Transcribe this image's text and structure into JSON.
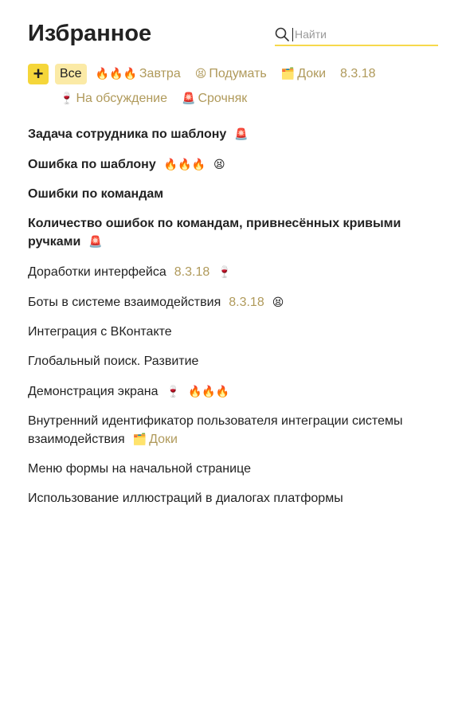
{
  "header": {
    "title": "Избранное",
    "search_placeholder": "Найти"
  },
  "filters": {
    "add_label": "+",
    "row1": [
      {
        "emoji": "",
        "label": "Все",
        "active": true
      },
      {
        "emoji": "🔥🔥🔥",
        "label": "Завтра"
      },
      {
        "emoji": "😫",
        "label": "Подумать"
      },
      {
        "emoji": "🗂️",
        "label": "Доки"
      },
      {
        "emoji": "",
        "label": "8.3.18"
      }
    ],
    "row2": [
      {
        "emoji": "🍷",
        "label": "На обсуждение"
      },
      {
        "emoji": "🚨",
        "label": "Срочняк"
      }
    ]
  },
  "items": [
    {
      "text": "Задача сотрудника по шаблону",
      "bold": true,
      "tags": [
        {
          "emoji": "🚨",
          "label": ""
        }
      ]
    },
    {
      "text": "Ошибка по шаблону",
      "bold": true,
      "tags": [
        {
          "emoji": "🔥🔥🔥",
          "label": ""
        },
        {
          "emoji": "😫",
          "label": ""
        }
      ]
    },
    {
      "text": "Ошибки по командам",
      "bold": true,
      "tags": []
    },
    {
      "text": "Количество ошибок по командам, привнесённых кривыми ручками",
      "bold": true,
      "tags": [
        {
          "emoji": "🚨",
          "label": ""
        }
      ]
    },
    {
      "text": "Доработки интерфейса",
      "bold": false,
      "tags": [
        {
          "emoji": "",
          "label": "8.3.18"
        },
        {
          "emoji": "🍷",
          "label": ""
        }
      ]
    },
    {
      "text": "Боты в системе взаимодействия",
      "bold": false,
      "tags": [
        {
          "emoji": "",
          "label": "8.3.18"
        },
        {
          "emoji": "😫",
          "label": ""
        }
      ]
    },
    {
      "text": "Интеграция с ВКонтакте",
      "bold": false,
      "tags": []
    },
    {
      "text": "Глобальный поиск. Развитие",
      "bold": false,
      "tags": []
    },
    {
      "text": "Демонстрация экрана",
      "bold": false,
      "tags": [
        {
          "emoji": "🍷",
          "label": ""
        },
        {
          "emoji": "🔥🔥🔥",
          "label": ""
        }
      ]
    },
    {
      "text": "Внутренний идентификатор пользователя интеграции системы взаимодействия",
      "bold": false,
      "tags": [
        {
          "emoji": "🗂️",
          "label": "Доки"
        }
      ]
    },
    {
      "text": "Меню формы на начальной странице",
      "bold": false,
      "tags": []
    },
    {
      "text": "Использование иллюстраций в диалогах платформы",
      "bold": false,
      "tags": []
    }
  ]
}
